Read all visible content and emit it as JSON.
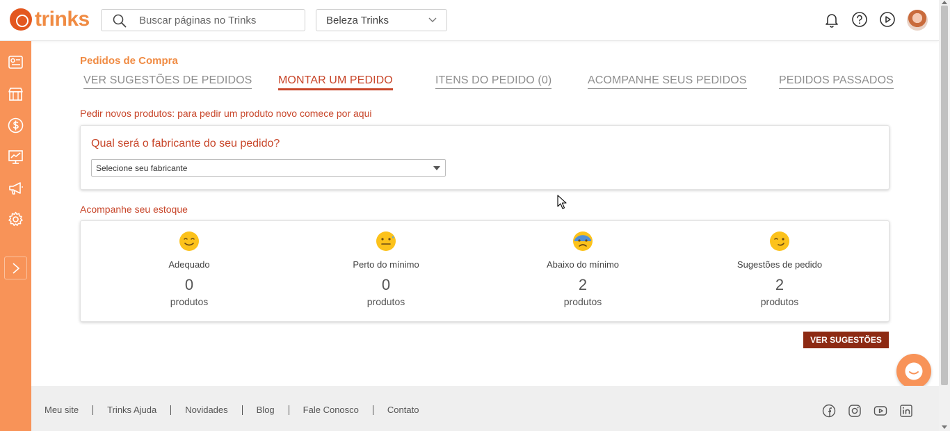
{
  "brand": {
    "logo_text": "trinks",
    "accent": "#f89358",
    "primary": "#c8462a",
    "dark": "#8d2a13"
  },
  "header": {
    "search_placeholder": "Buscar páginas no Trinks",
    "store_selected": "Beleza Trinks",
    "icons": [
      "bell-icon",
      "help-icon",
      "play-icon",
      "avatar"
    ]
  },
  "sidebar": {
    "icons": [
      "dashboard-icon",
      "store-icon",
      "dollar-icon",
      "chart-icon",
      "megaphone-icon",
      "gear-icon",
      "chevron-right-icon"
    ]
  },
  "main": {
    "page_title": "Pedidos de Compra",
    "tabs": [
      {
        "label": "VER SUGESTÕES DE PEDIDOS"
      },
      {
        "label": "MONTAR UM PEDIDO"
      },
      {
        "label": "ITENS DO PEDIDO (0)"
      },
      {
        "label": "ACOMPANHE SEUS PEDIDOS"
      },
      {
        "label": "PEDIDOS PASSADOS"
      }
    ],
    "active_tab": "MONTAR UM PEDIDO",
    "intro": "Pedir novos produtos: para pedir um produto novo comece por aqui",
    "manufacturer_question": "Qual será o fabricante do seu pedido?",
    "manufacturer_select": "Selecione seu fabricante",
    "stock_title": "Acompanhe seu estoque",
    "stats": [
      {
        "label": "Adequado",
        "count": "0",
        "unit": "produtos"
      },
      {
        "label": "Perto do mínimo",
        "count": "0",
        "unit": "produtos"
      },
      {
        "label": "Abaixo do mínimo",
        "count": "2",
        "unit": "produtos"
      },
      {
        "label": "Sugestões de pedido",
        "count": "2",
        "unit": "produtos"
      }
    ],
    "cta": "VER SUGESTÕES"
  },
  "footer": {
    "links": [
      "Meu site",
      "Trinks Ajuda",
      "Novidades",
      "Blog",
      "Fale Conosco",
      "Contato"
    ],
    "social": [
      "facebook-icon",
      "instagram-icon",
      "youtube-icon",
      "linkedin-icon"
    ]
  }
}
